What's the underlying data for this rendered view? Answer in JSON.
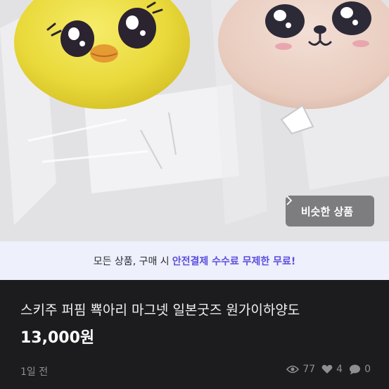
{
  "photo": {
    "similar_button_label": "비슷한 상품",
    "similar_button_icon": "chevron-right-icon"
  },
  "promo": {
    "text_prefix": "모든 상품, 구매 시",
    "text_accent": "안전결제 수수료 무제한 무료!",
    "accent_color": "#5b4fe0"
  },
  "product": {
    "title": "스키주 퍼핌 뾱아리 마그넷 일본굿즈 원가이하양도",
    "price": "13,000원",
    "posted_time": "1일 전",
    "views": "77",
    "likes": "4",
    "chats": "0"
  }
}
